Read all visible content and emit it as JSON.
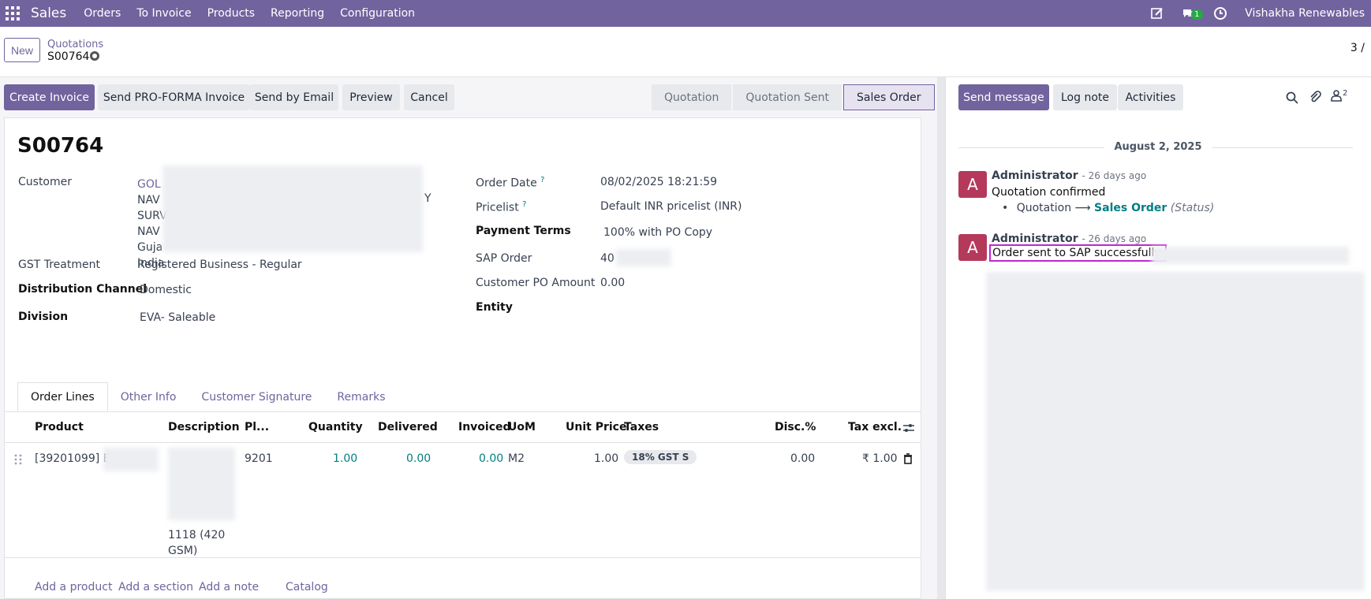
{
  "topbar": {
    "brand": "Sales",
    "menu": [
      "Orders",
      "To Invoice",
      "Products",
      "Reporting",
      "Configuration"
    ],
    "chat_badge": "1",
    "company": "Vishakha Renewables"
  },
  "control": {
    "new_label": "New",
    "breadcrumb_parent": "Quotations",
    "breadcrumb_current": "S00764",
    "pager": "3 /"
  },
  "actions": {
    "create_invoice": "Create Invoice",
    "send_proforma": "Send PRO-FORMA Invoice",
    "send_email": "Send by Email",
    "preview": "Preview",
    "cancel": "Cancel"
  },
  "statusbar": [
    "Quotation",
    "Quotation Sent",
    "Sales Order"
  ],
  "form": {
    "title": "S00764",
    "left": {
      "customer_label": "Customer",
      "customer_lines": [
        "GOL",
        "NAV",
        "SURV",
        "NAV",
        "Guja",
        "India"
      ],
      "customer_tail": "Y",
      "gst_label": "GST Treatment",
      "gst_value": "Registered Business - Regular",
      "dist_label": "Distribution Channel",
      "dist_value": "Domestic",
      "division_label": "Division",
      "division_value": "EVA- Saleable"
    },
    "right": {
      "order_date_label": "Order Date",
      "order_date_value": "08/02/2025 18:21:59",
      "pricelist_label": "Pricelist",
      "pricelist_value": "Default INR pricelist (INR)",
      "payment_label": "Payment Terms",
      "payment_value": "100% with PO Copy",
      "sap_label": "SAP Order",
      "sap_value": "40",
      "po_amount_label": "Customer PO Amount",
      "po_amount_value": "0.00",
      "entity_label": "Entity",
      "help_mark": "?"
    }
  },
  "tabs": [
    "Order Lines",
    "Other Info",
    "Customer Signature",
    "Remarks"
  ],
  "table": {
    "headers": [
      "Product",
      "Description",
      "Pl...",
      "Quantity",
      "Delivered",
      "Invoiced",
      "UoM",
      "Unit Price",
      "Taxes",
      "Disc.%",
      "Tax excl."
    ],
    "row": {
      "product": "[39201099] E",
      "description_tail_1": "1118 (420",
      "description_tail_2": "GSM)",
      "pl": "9201",
      "quantity": "1.00",
      "delivered": "0.00",
      "invoiced": "0.00",
      "uom": "M2",
      "unit_price": "1.00",
      "taxes": "18% GST S",
      "disc": "0.00",
      "tax_excl": "₹ 1.00"
    },
    "footer": [
      "Add a product",
      "Add a section",
      "Add a note",
      "Catalog"
    ]
  },
  "chatter": {
    "send_message": "Send message",
    "log_note": "Log note",
    "activities": "Activities",
    "followers_count": "2",
    "date": "August 2, 2025",
    "messages": [
      {
        "avatar": "A",
        "author": "Administrator",
        "ago": "- 26 days ago",
        "body": "Quotation confirmed",
        "track_old": "Quotation",
        "track_arrow": "⟶",
        "track_new": "Sales Order",
        "track_field": "(Status)"
      },
      {
        "avatar": "A",
        "author": "Administrator",
        "ago": "- 26 days ago",
        "body": "Order sent to SAP successfully:"
      }
    ]
  }
}
